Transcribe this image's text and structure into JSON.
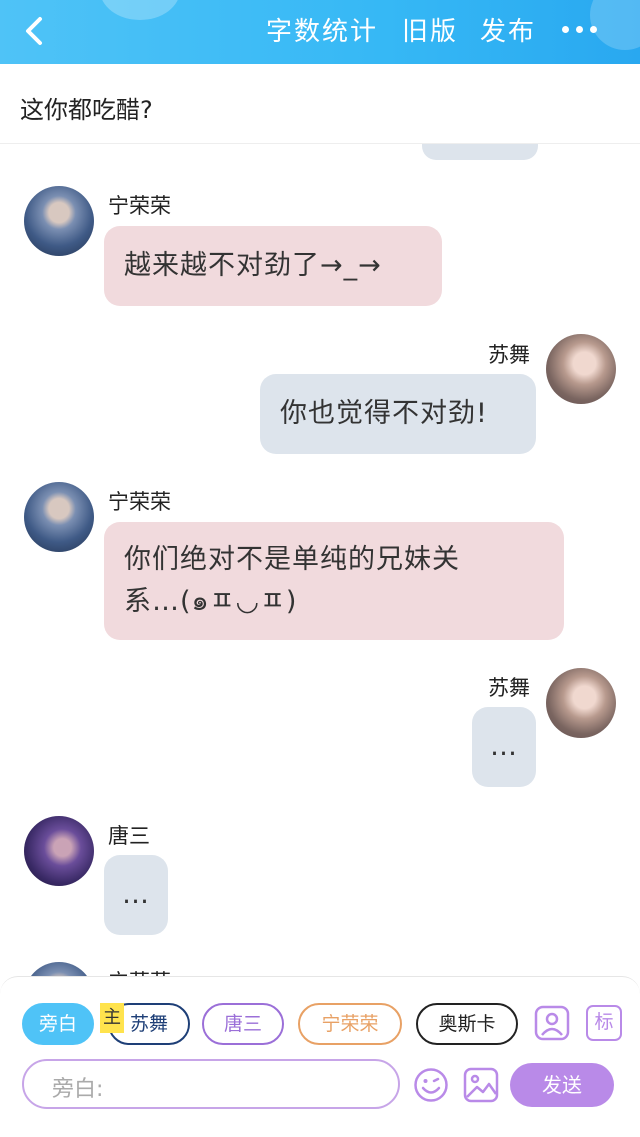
{
  "header": {
    "actions": [
      "字数统计",
      "旧版",
      "发布"
    ]
  },
  "subject": "这你都吃醋?",
  "messages": [
    {
      "name": "宁荣荣",
      "text": "越来越不对劲了→_→"
    },
    {
      "name": "苏舞",
      "text": "你也觉得不对劲!"
    },
    {
      "name": "宁荣荣",
      "text_line1": "你们绝对不是单纯的兄妹关",
      "text_line2": "系…(๑ㅍ◡ㅍ)"
    },
    {
      "name": "苏舞",
      "text": "…"
    },
    {
      "name": "唐三",
      "text": "…"
    },
    {
      "name": "宁荣荣"
    }
  ],
  "roles": {
    "narrator": "旁白",
    "main_tag": "主",
    "xiao_wu": "苏舞",
    "tang_san": "唐三",
    "ning": "宁荣荣",
    "ao": "奥斯卡"
  },
  "tools": {
    "avatar_toggle": "person-icon",
    "mark_label": "标"
  },
  "composer": {
    "placeholder": "旁白:",
    "send_label": "发送"
  },
  "colors": {
    "header": "#36b8f5",
    "bubble_left": "#f1dadd",
    "bubble_right": "#dde4ec",
    "send": "#b98ae8"
  }
}
